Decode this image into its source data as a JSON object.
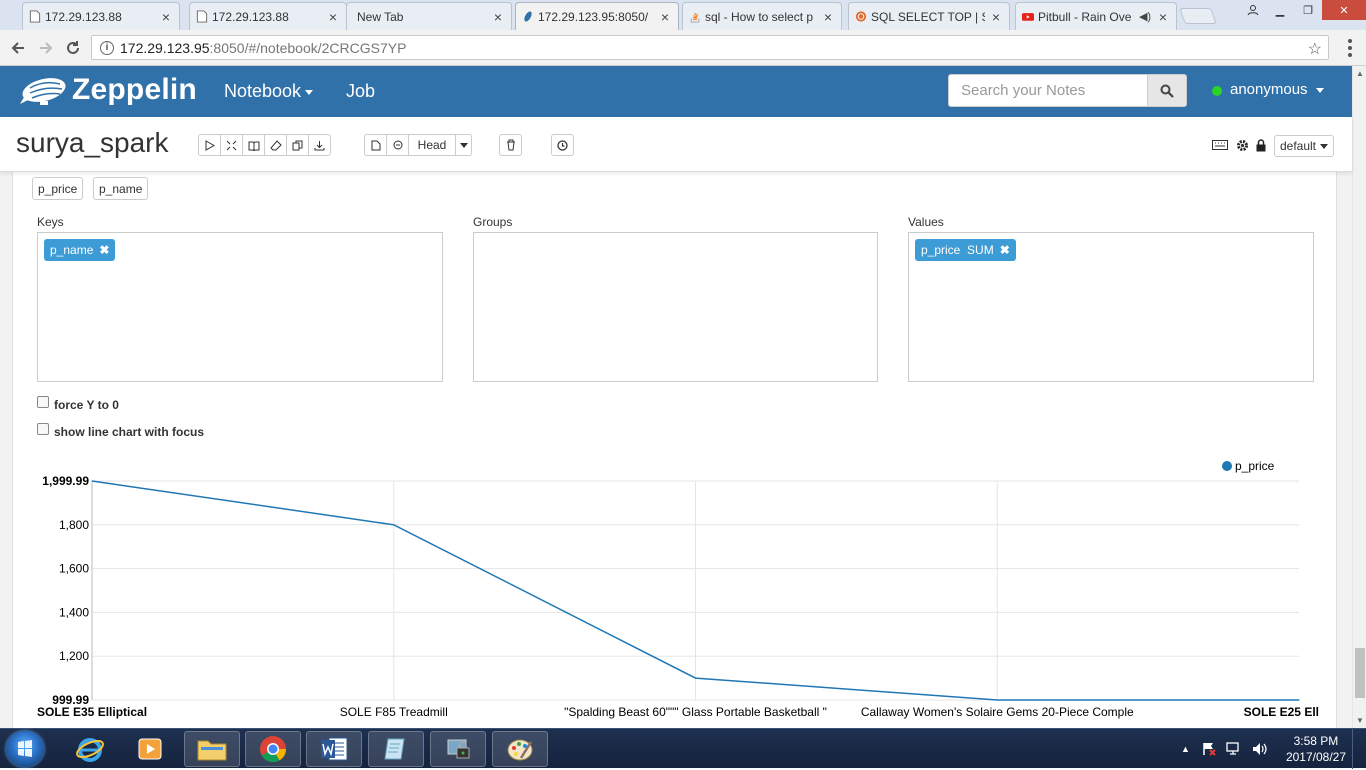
{
  "browser": {
    "tabs": [
      {
        "title": "172.29.123.88",
        "icon": "document-icon"
      },
      {
        "title": "172.29.123.88",
        "icon": "document-icon"
      },
      {
        "title": "New Tab",
        "icon": ""
      },
      {
        "title": "172.29.123.95:8050/",
        "icon": "zeppelin-icon"
      },
      {
        "title": "sql - How to select p",
        "icon": "stackoverflow-icon"
      },
      {
        "title": "SQL SELECT TOP | S",
        "icon": "w3schools-icon"
      },
      {
        "title": "Pitbull - Rain Ove",
        "icon": "youtube-icon"
      }
    ],
    "close_glyph": "×",
    "url_host": "172.29.123.95",
    "url_rest": ":8050/#/notebook/2CRCGS7YP"
  },
  "navbar": {
    "brand": "Zeppelin",
    "notebook_menu": "Notebook",
    "job_menu": "Job",
    "search_placeholder": "Search your Notes",
    "user": "anonymous",
    "user_status_color": "#2bd327",
    "bar_color": "#3071a9"
  },
  "notebook": {
    "title": "surya_spark",
    "head_label": "Head",
    "interpreter_label": "default"
  },
  "paragraph": {
    "fields": [
      "p_price",
      "p_name"
    ],
    "keys_label": "Keys",
    "groups_label": "Groups",
    "values_label": "Values",
    "keys_chip": "p_name",
    "values_chip": "p_price  SUM",
    "force_y_label": "force Y to 0",
    "line_focus_label": "show line chart with focus"
  },
  "chart_data": {
    "type": "line",
    "categories": [
      "SOLE E35 Elliptical",
      "SOLE F85 Treadmill",
      "\"Spalding Beast 60\"\"\" Glass Portable Basketball \"",
      "Callaway Women's Solaire Gems 20-Piece Comple",
      "SOLE E25 Ell"
    ],
    "series": [
      {
        "name": "p_price",
        "values": [
          1999.99,
          1799.99,
          1099.99,
          999.99,
          999.99
        ],
        "color": "#1f77b4"
      }
    ],
    "ylim": [
      999.99,
      1999.99
    ],
    "y_ticks": [
      {
        "value": 999.99,
        "label": "999.99",
        "bold": true
      },
      {
        "value": 1200,
        "label": "1,200",
        "bold": false
      },
      {
        "value": 1400,
        "label": "1,400",
        "bold": false
      },
      {
        "value": 1600,
        "label": "1,600",
        "bold": false
      },
      {
        "value": 1800,
        "label": "1,800",
        "bold": false
      },
      {
        "value": 1999.99,
        "label": "1,999.99",
        "bold": true
      }
    ],
    "legend_position": "top-right",
    "grid": true
  },
  "taskbar": {
    "time": "3:58 PM",
    "date": "2017/08/27",
    "apps": [
      "internet-explorer-icon",
      "media-player-icon",
      "file-explorer-icon",
      "chrome-icon",
      "word-icon",
      "notes-icon",
      "vpn-icon",
      "paint-icon"
    ]
  }
}
